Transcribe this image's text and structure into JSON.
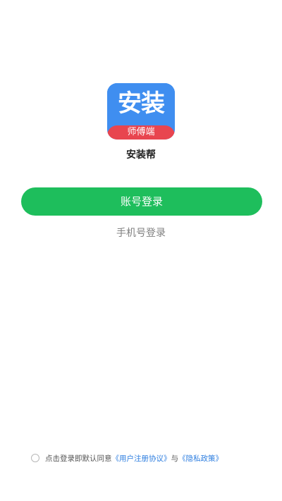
{
  "app": {
    "logo_main": "安装",
    "logo_sub": "师傅端",
    "name": "安装帮"
  },
  "login": {
    "account_button": "账号登录",
    "phone_link": "手机号登录"
  },
  "agreement": {
    "prefix": "点击登录即默认同意",
    "user_agreement": "《用户注册协议》",
    "connector": "与",
    "privacy_policy": "《隐私政策》"
  },
  "colors": {
    "primary_green": "#1ebe5c",
    "logo_blue": "#3f8ef0",
    "logo_red": "#e8454f",
    "link_blue": "#2f7fe0"
  }
}
